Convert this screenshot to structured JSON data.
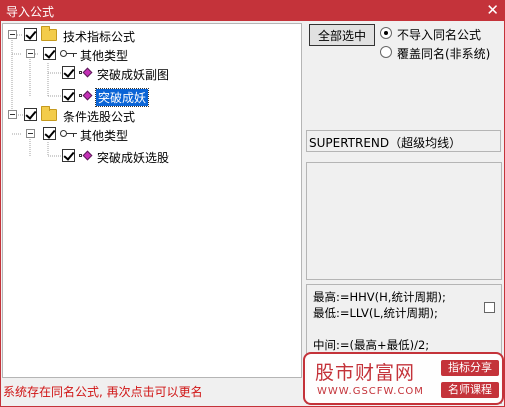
{
  "window": {
    "title": "导入公式",
    "close_glyph": "✕",
    "accent_color": "#c4333a"
  },
  "tree": {
    "nodes": [
      {
        "label": "技术指标公式",
        "checked": true,
        "icon": "folder-icon",
        "level": 0
      },
      {
        "label": "其他类型",
        "checked": true,
        "icon": "key-icon",
        "level": 1
      },
      {
        "label": "突破成妖副图",
        "checked": true,
        "icon": "formula-icon",
        "level": 2
      },
      {
        "label": "突破成妖",
        "checked": true,
        "icon": "formula-icon",
        "level": 2,
        "selected": true
      },
      {
        "label": "条件选股公式",
        "checked": true,
        "icon": "folder-icon",
        "level": 0
      },
      {
        "label": "其他类型",
        "checked": true,
        "icon": "key-icon",
        "level": 1
      },
      {
        "label": "突破成妖选股",
        "checked": true,
        "icon": "formula-icon",
        "level": 2
      }
    ]
  },
  "options": {
    "select_all_label": "全部选中",
    "radio_skip_label": "不导入同名公式",
    "radio_overwrite_label": "覆盖同名(非系统)",
    "selected_radio": "skip"
  },
  "details": {
    "formula_name": "SUPERTREND（超级均线）",
    "code_lines": [
      "最高:=HHV(H,统计周期);",
      "最低:=LLV(L,统计周期);",
      "",
      "中间:=(最高+最低)/2;"
    ]
  },
  "status": {
    "message": "系统存在同名公式, 再次点击可以更名",
    "color": "#d01414"
  },
  "watermark": {
    "site_name": "股市财富网",
    "url": "WWW.GSCFW.COM",
    "tag_1": "指标分享",
    "tag_2": "名师课程"
  }
}
